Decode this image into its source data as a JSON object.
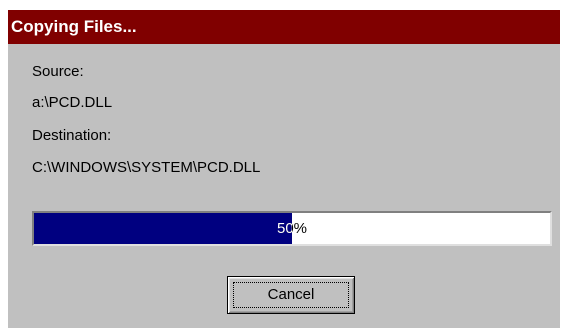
{
  "window": {
    "title": "Copying Files...",
    "title_bar_color": "#800000",
    "face_color": "#c0c0c0"
  },
  "source": {
    "label": "Source:",
    "value": "a:\\PCD.DLL"
  },
  "destination": {
    "label": "Destination:",
    "value": "C:\\WINDOWS\\SYSTEM\\PCD.DLL"
  },
  "progress": {
    "percent": 50,
    "text": "50%",
    "fill_color": "#000080"
  },
  "buttons": {
    "cancel_label": "Cancel"
  }
}
